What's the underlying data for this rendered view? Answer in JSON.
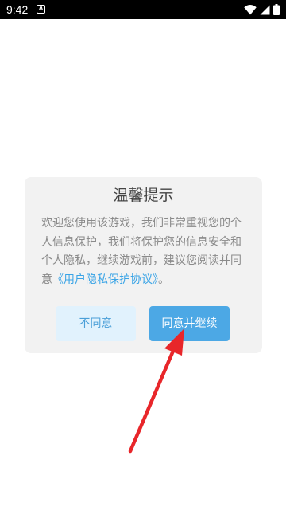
{
  "status_bar": {
    "time": "9:42",
    "notification_badge": "A",
    "icons": [
      "wifi-icon",
      "signal-icon",
      "battery-icon"
    ]
  },
  "dialog": {
    "title": "温馨提示",
    "body_text": "欢迎您使用该游戏，我们非常重视您的个人信息保护，我们将保护您的信息安全和个人隐私，继续游戏前，建议您阅读并同意",
    "agreement_link": "《用户隐私保护协议》",
    "body_end": "。",
    "disagree_label": "不同意",
    "agree_label": "同意并继续"
  },
  "annotation": {
    "type": "red-arrow",
    "color": "#e8262a",
    "points_to": "agree-button"
  },
  "colors": {
    "accent": "#4ca8e5",
    "accent_light": "#e1f2fd",
    "link": "#3aa4e6",
    "dialog_bg": "#f2f2f2"
  }
}
